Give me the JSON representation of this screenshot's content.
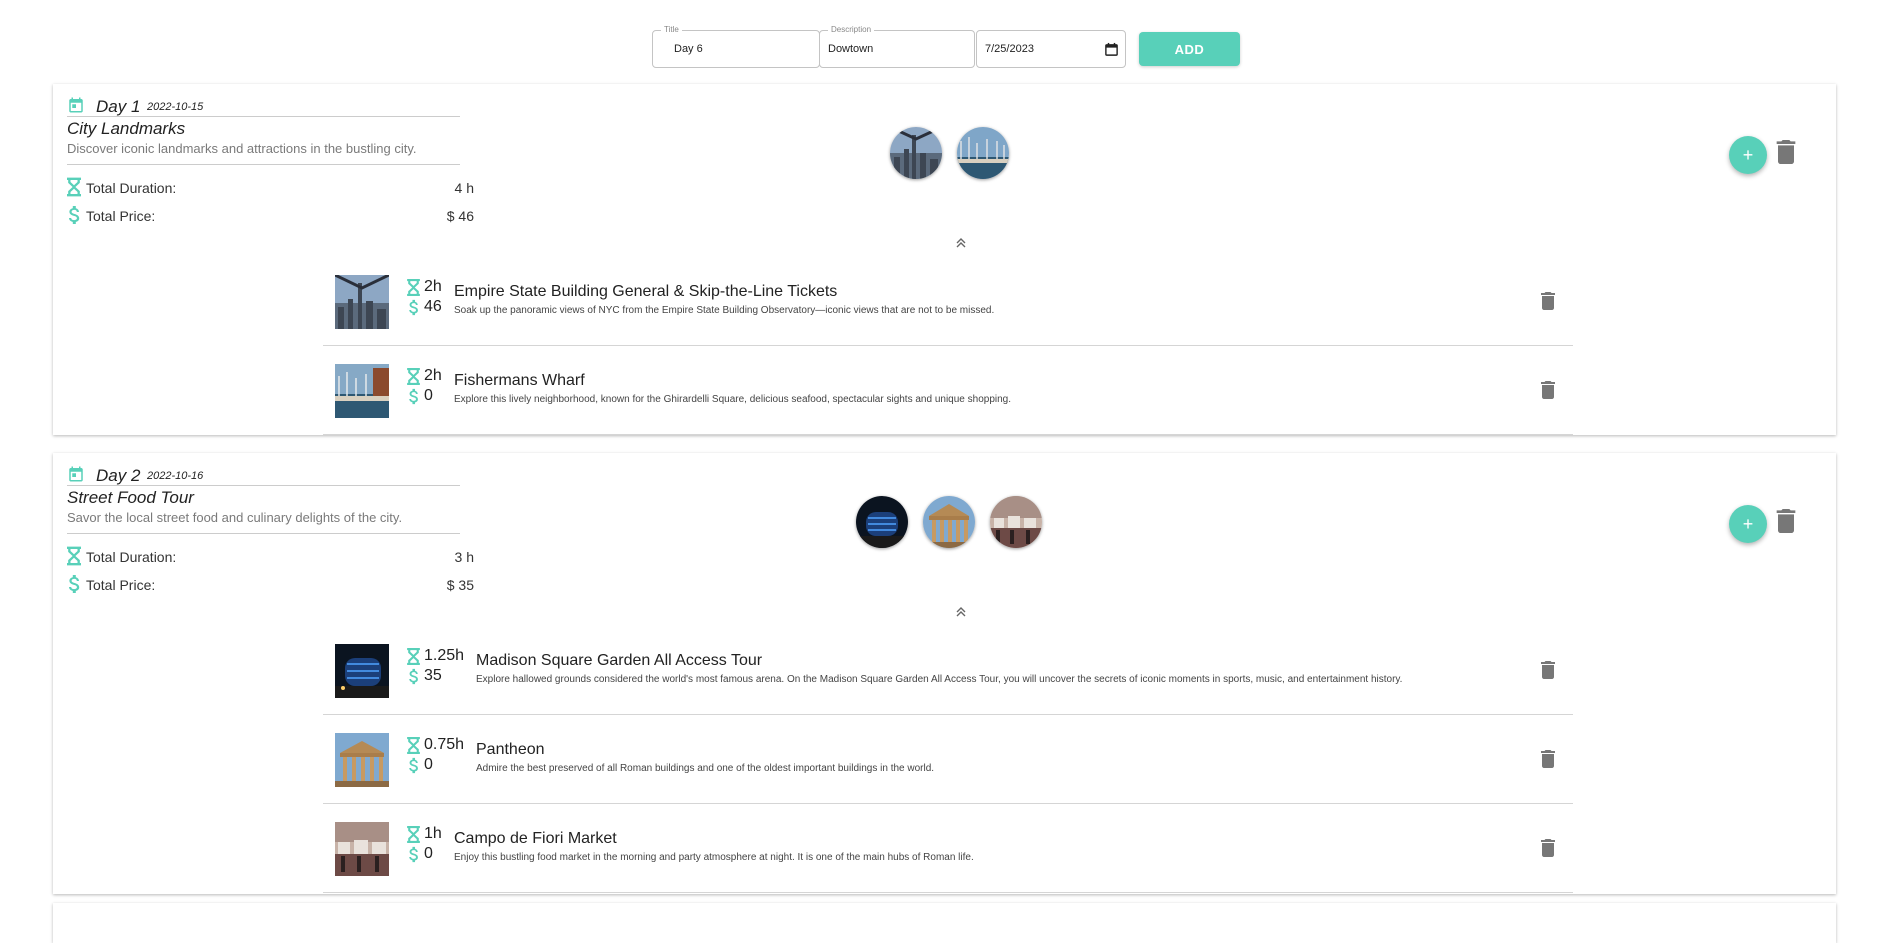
{
  "form": {
    "title_label": "Title",
    "title_value": "Day 6",
    "description_label": "Description",
    "description_value": "Dowtown",
    "date_value": "7/25/2023",
    "add_label": "ADD"
  },
  "colors": {
    "accent": "#58d0b9",
    "icon_gray": "#777777"
  },
  "days": [
    {
      "label": "Day 1",
      "date": "2022-10-15",
      "title": "City Landmarks",
      "description": "Discover iconic landmarks and attractions in the bustling city.",
      "duration_label": "Total Duration:",
      "duration_value": "4 h",
      "price_label": "Total Price:",
      "price_value": "$ 46",
      "add_icon": "+",
      "activities": [
        {
          "duration": "2h",
          "price": "46",
          "name": "Empire State Building General & Skip-the-Line Tickets",
          "description": "Soak up the panoramic views of NYC from the Empire State Building Observatory—iconic views that are not to be missed."
        },
        {
          "duration": "2h",
          "price": "0",
          "name": "Fishermans Wharf",
          "description": "Explore this lively neighborhood, known for the Ghirardelli Square, delicious seafood, spectacular sights and unique shopping."
        }
      ]
    },
    {
      "label": "Day 2",
      "date": "2022-10-16",
      "title": "Street Food Tour",
      "description": "Savor the local street food and culinary delights of the city.",
      "duration_label": "Total Duration:",
      "duration_value": "3 h",
      "price_label": "Total Price:",
      "price_value": "$ 35",
      "add_icon": "+",
      "activities": [
        {
          "duration": "1.25h",
          "price": "35",
          "name": "Madison Square Garden All Access Tour",
          "description": "Explore hallowed grounds considered the world's most famous arena. On the Madison Square Garden All Access Tour, you will uncover the secrets of iconic moments in sports, music, and entertainment history."
        },
        {
          "duration": "0.75h",
          "price": "0",
          "name": "Pantheon",
          "description": "Admire the best preserved of all Roman buildings and one of the oldest important buildings in the world."
        },
        {
          "duration": "1h",
          "price": "0",
          "name": "Campo de Fiori Market",
          "description": "Enjoy this bustling food market in the morning and party atmosphere at night. It is one of the main hubs of Roman life."
        }
      ]
    }
  ]
}
